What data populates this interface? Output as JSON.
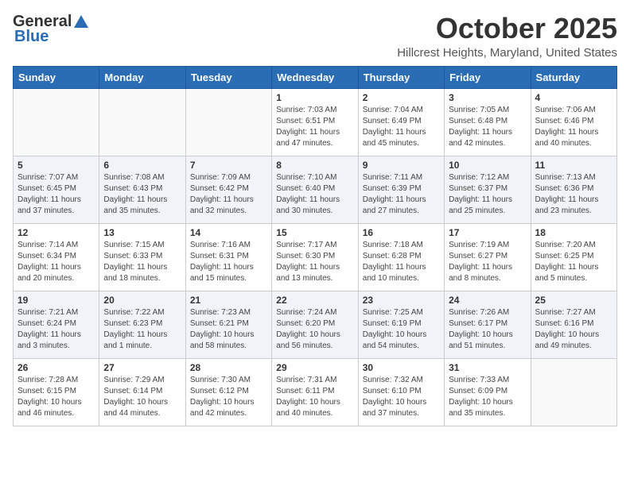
{
  "logo": {
    "general": "General",
    "blue": "Blue"
  },
  "title": "October 2025",
  "subtitle": "Hillcrest Heights, Maryland, United States",
  "headers": [
    "Sunday",
    "Monday",
    "Tuesday",
    "Wednesday",
    "Thursday",
    "Friday",
    "Saturday"
  ],
  "weeks": [
    [
      {
        "day": "",
        "info": ""
      },
      {
        "day": "",
        "info": ""
      },
      {
        "day": "",
        "info": ""
      },
      {
        "day": "1",
        "info": "Sunrise: 7:03 AM\nSunset: 6:51 PM\nDaylight: 11 hours\nand 47 minutes."
      },
      {
        "day": "2",
        "info": "Sunrise: 7:04 AM\nSunset: 6:49 PM\nDaylight: 11 hours\nand 45 minutes."
      },
      {
        "day": "3",
        "info": "Sunrise: 7:05 AM\nSunset: 6:48 PM\nDaylight: 11 hours\nand 42 minutes."
      },
      {
        "day": "4",
        "info": "Sunrise: 7:06 AM\nSunset: 6:46 PM\nDaylight: 11 hours\nand 40 minutes."
      }
    ],
    [
      {
        "day": "5",
        "info": "Sunrise: 7:07 AM\nSunset: 6:45 PM\nDaylight: 11 hours\nand 37 minutes."
      },
      {
        "day": "6",
        "info": "Sunrise: 7:08 AM\nSunset: 6:43 PM\nDaylight: 11 hours\nand 35 minutes."
      },
      {
        "day": "7",
        "info": "Sunrise: 7:09 AM\nSunset: 6:42 PM\nDaylight: 11 hours\nand 32 minutes."
      },
      {
        "day": "8",
        "info": "Sunrise: 7:10 AM\nSunset: 6:40 PM\nDaylight: 11 hours\nand 30 minutes."
      },
      {
        "day": "9",
        "info": "Sunrise: 7:11 AM\nSunset: 6:39 PM\nDaylight: 11 hours\nand 27 minutes."
      },
      {
        "day": "10",
        "info": "Sunrise: 7:12 AM\nSunset: 6:37 PM\nDaylight: 11 hours\nand 25 minutes."
      },
      {
        "day": "11",
        "info": "Sunrise: 7:13 AM\nSunset: 6:36 PM\nDaylight: 11 hours\nand 23 minutes."
      }
    ],
    [
      {
        "day": "12",
        "info": "Sunrise: 7:14 AM\nSunset: 6:34 PM\nDaylight: 11 hours\nand 20 minutes."
      },
      {
        "day": "13",
        "info": "Sunrise: 7:15 AM\nSunset: 6:33 PM\nDaylight: 11 hours\nand 18 minutes."
      },
      {
        "day": "14",
        "info": "Sunrise: 7:16 AM\nSunset: 6:31 PM\nDaylight: 11 hours\nand 15 minutes."
      },
      {
        "day": "15",
        "info": "Sunrise: 7:17 AM\nSunset: 6:30 PM\nDaylight: 11 hours\nand 13 minutes."
      },
      {
        "day": "16",
        "info": "Sunrise: 7:18 AM\nSunset: 6:28 PM\nDaylight: 11 hours\nand 10 minutes."
      },
      {
        "day": "17",
        "info": "Sunrise: 7:19 AM\nSunset: 6:27 PM\nDaylight: 11 hours\nand 8 minutes."
      },
      {
        "day": "18",
        "info": "Sunrise: 7:20 AM\nSunset: 6:25 PM\nDaylight: 11 hours\nand 5 minutes."
      }
    ],
    [
      {
        "day": "19",
        "info": "Sunrise: 7:21 AM\nSunset: 6:24 PM\nDaylight: 11 hours\nand 3 minutes."
      },
      {
        "day": "20",
        "info": "Sunrise: 7:22 AM\nSunset: 6:23 PM\nDaylight: 11 hours\nand 1 minute."
      },
      {
        "day": "21",
        "info": "Sunrise: 7:23 AM\nSunset: 6:21 PM\nDaylight: 10 hours\nand 58 minutes."
      },
      {
        "day": "22",
        "info": "Sunrise: 7:24 AM\nSunset: 6:20 PM\nDaylight: 10 hours\nand 56 minutes."
      },
      {
        "day": "23",
        "info": "Sunrise: 7:25 AM\nSunset: 6:19 PM\nDaylight: 10 hours\nand 54 minutes."
      },
      {
        "day": "24",
        "info": "Sunrise: 7:26 AM\nSunset: 6:17 PM\nDaylight: 10 hours\nand 51 minutes."
      },
      {
        "day": "25",
        "info": "Sunrise: 7:27 AM\nSunset: 6:16 PM\nDaylight: 10 hours\nand 49 minutes."
      }
    ],
    [
      {
        "day": "26",
        "info": "Sunrise: 7:28 AM\nSunset: 6:15 PM\nDaylight: 10 hours\nand 46 minutes."
      },
      {
        "day": "27",
        "info": "Sunrise: 7:29 AM\nSunset: 6:14 PM\nDaylight: 10 hours\nand 44 minutes."
      },
      {
        "day": "28",
        "info": "Sunrise: 7:30 AM\nSunset: 6:12 PM\nDaylight: 10 hours\nand 42 minutes."
      },
      {
        "day": "29",
        "info": "Sunrise: 7:31 AM\nSunset: 6:11 PM\nDaylight: 10 hours\nand 40 minutes."
      },
      {
        "day": "30",
        "info": "Sunrise: 7:32 AM\nSunset: 6:10 PM\nDaylight: 10 hours\nand 37 minutes."
      },
      {
        "day": "31",
        "info": "Sunrise: 7:33 AM\nSunset: 6:09 PM\nDaylight: 10 hours\nand 35 minutes."
      },
      {
        "day": "",
        "info": ""
      }
    ]
  ]
}
